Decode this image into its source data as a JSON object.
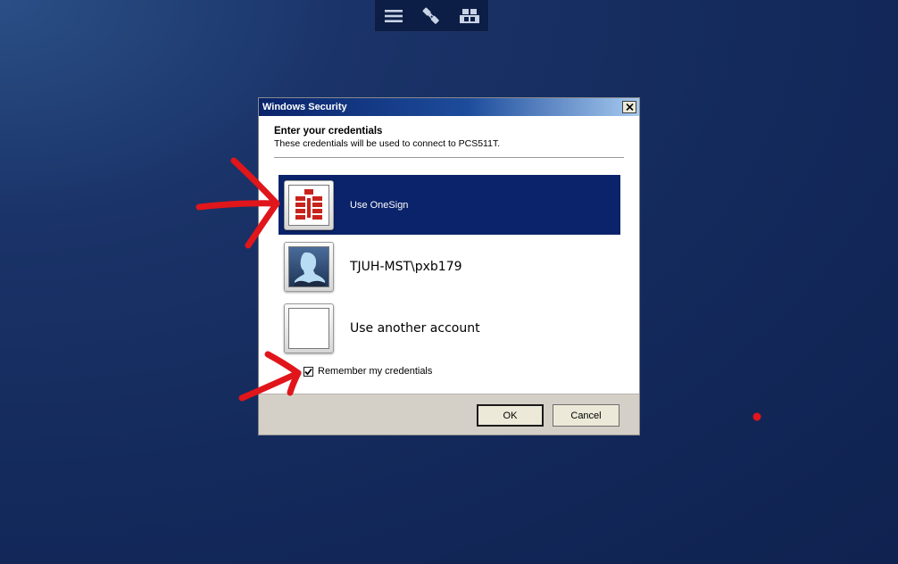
{
  "toolbar": {
    "icons": [
      "menu-icon",
      "connection-icon",
      "display-icon"
    ]
  },
  "dialog": {
    "title": "Windows Security",
    "header_title": "Enter your credentials",
    "header_subtitle": "These credentials will be used to connect to PCS511T.",
    "options": [
      {
        "label": "Use OneSign",
        "icon": "onesign-icon",
        "selected": true
      },
      {
        "label": "TJUH-MST\\pxb179",
        "icon": "user-profile-icon",
        "selected": false
      },
      {
        "label": "Use another account",
        "icon": "blank-account-icon",
        "selected": false
      }
    ],
    "remember_label": "Remember my credentials",
    "remember_checked": true,
    "ok_label": "OK",
    "cancel_label": "Cancel"
  },
  "colors": {
    "desktop": "#142a5c",
    "selection": "#0a236a",
    "annotation": "#e0161b"
  }
}
